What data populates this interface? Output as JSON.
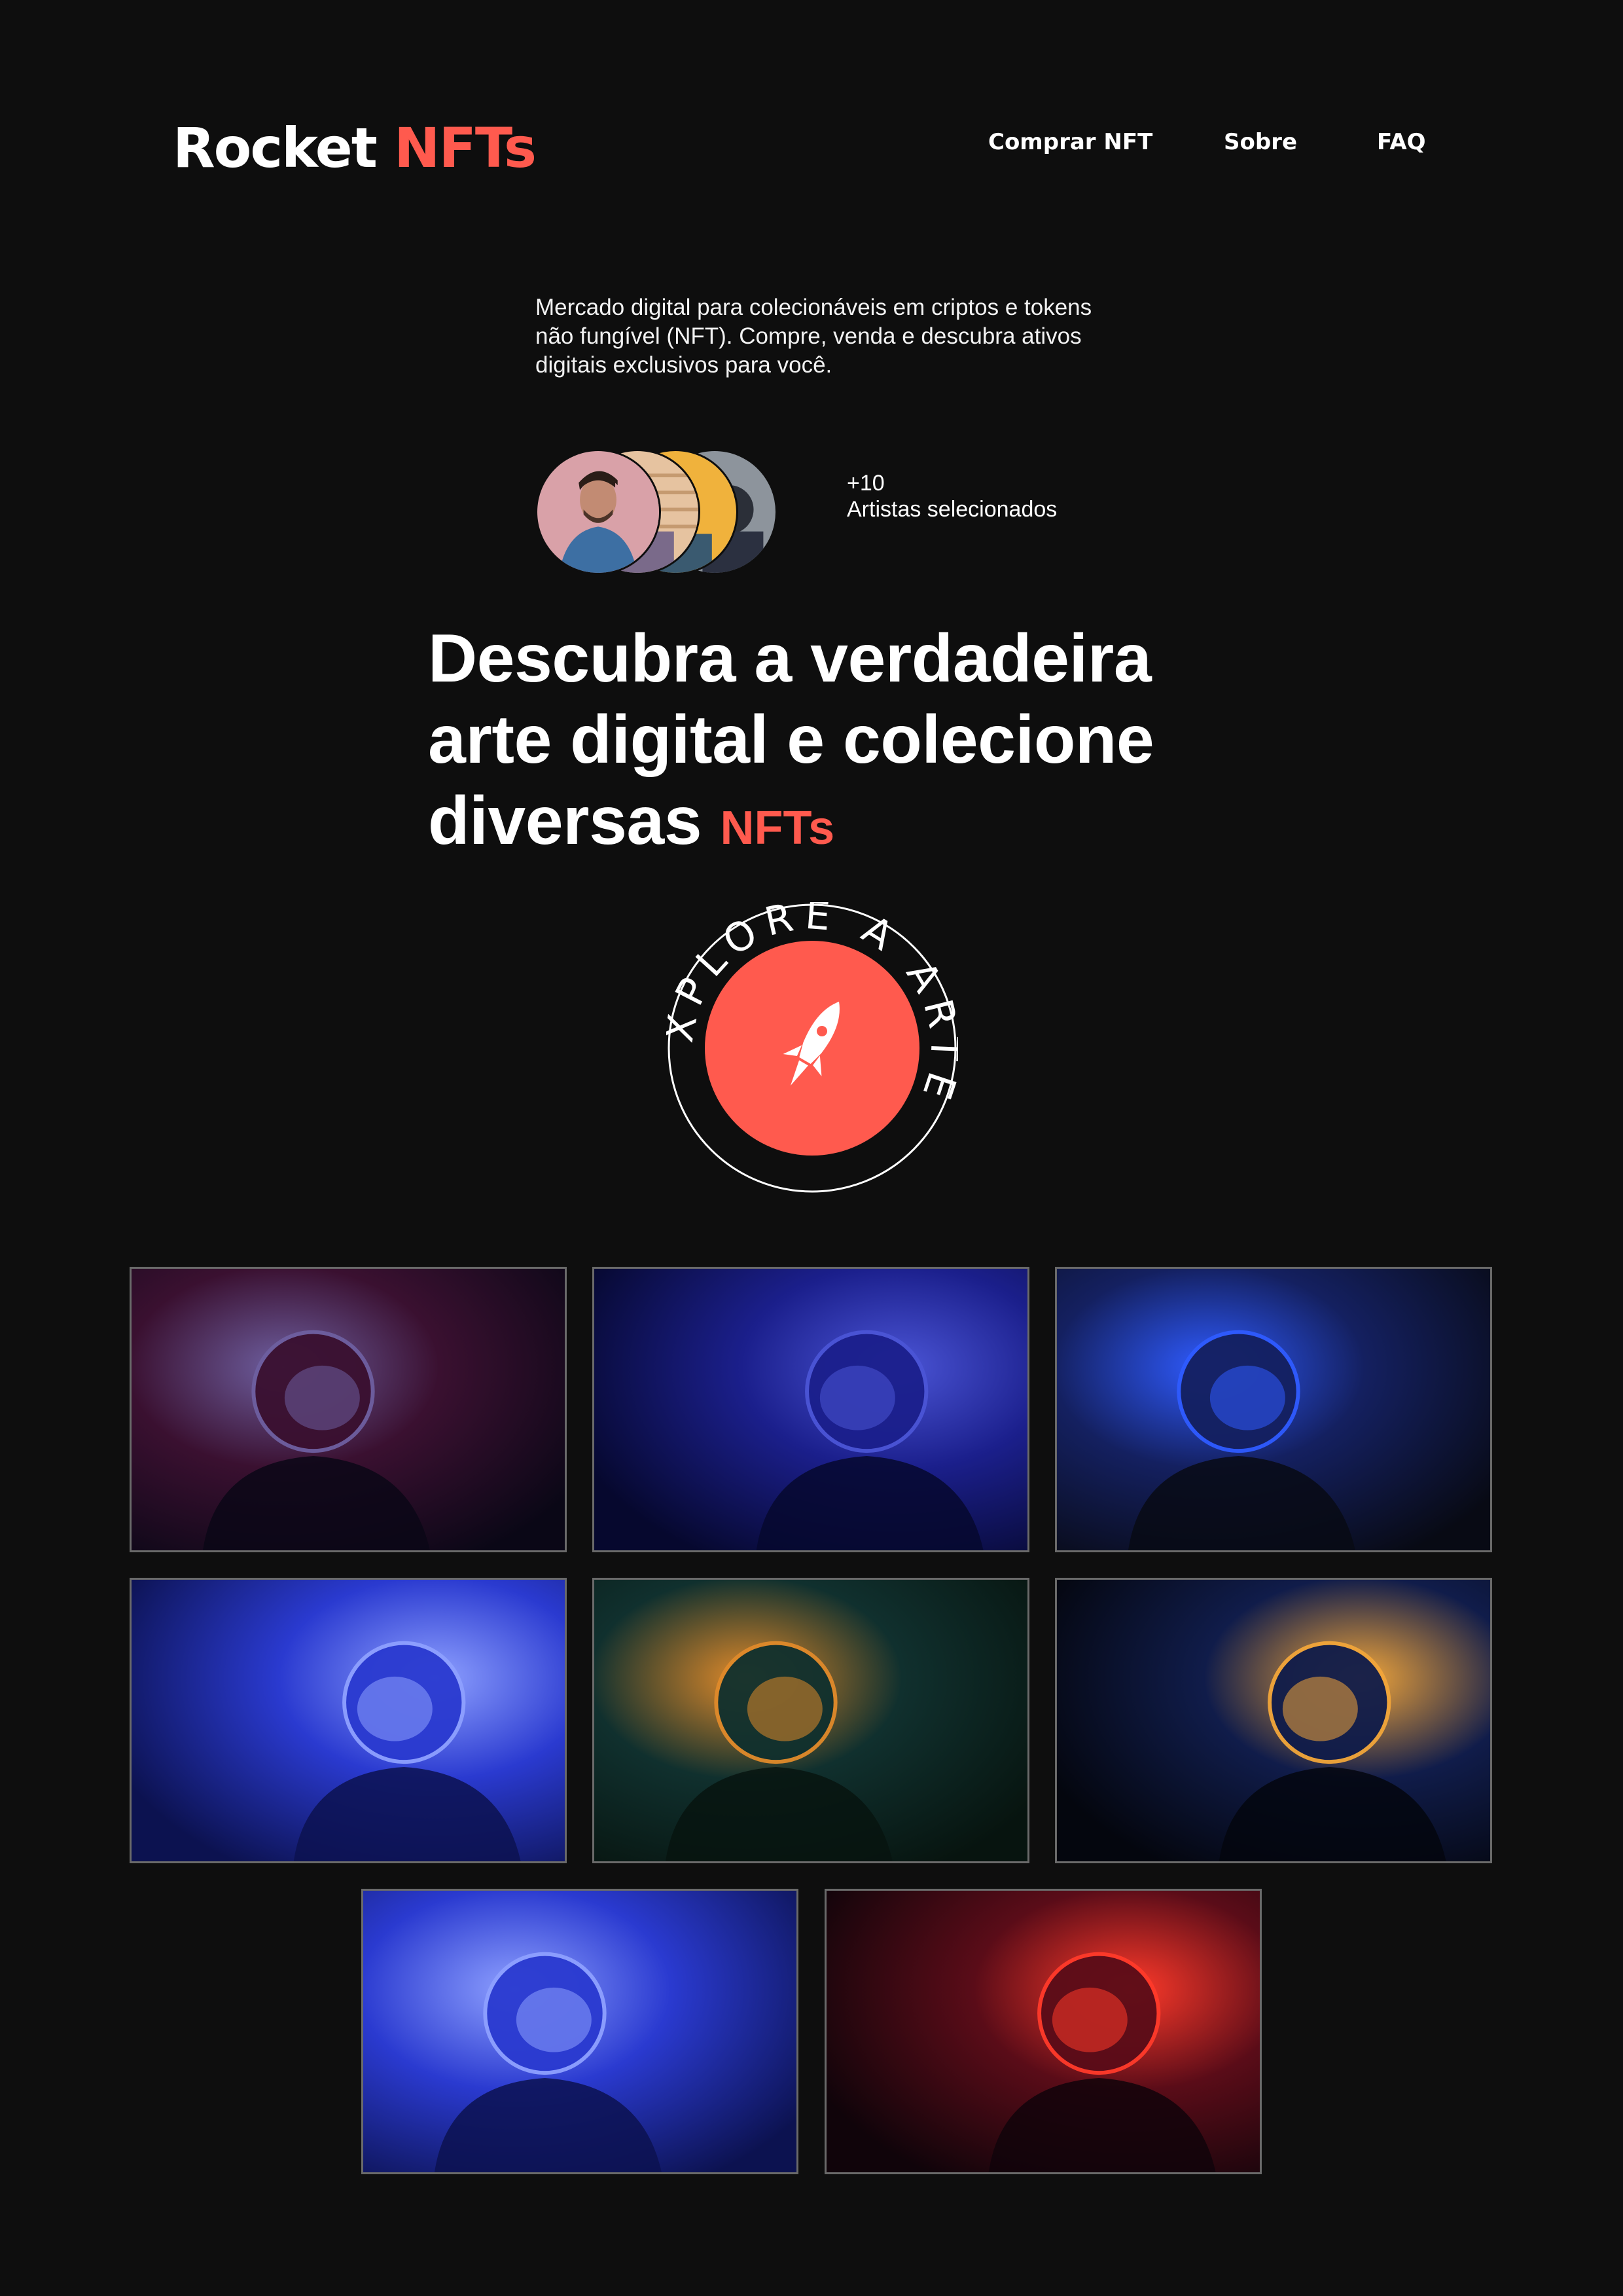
{
  "header": {
    "logo_main": "Rocket",
    "logo_accent": "NFTs",
    "nav": [
      "Comprar NFT",
      "Sobre",
      "FAQ"
    ]
  },
  "intro": {
    "description": "Mercado digital para colecionáveis em criptos e tokens não fungível (NFT). Compre, venda e descubra ativos digitais exclusivos para você.",
    "artists_count": "+10",
    "artists_label": "Artistas selecionados"
  },
  "headline": {
    "line1": "Descubra a verdadeira",
    "line2": "arte digital e colecione",
    "line3": "diversas",
    "accent": "NFTs"
  },
  "badge": {
    "text": "EXPLORE A ARTE",
    "icon": "rocket-icon"
  },
  "colors": {
    "background": "#0e0e0e",
    "accent": "#ff5a4e",
    "text": "#ffffff"
  },
  "gallery": [
    {
      "icon": "astronaut-photo",
      "palette": [
        "#0a0716",
        "#3a1030",
        "#6e5fa0"
      ]
    },
    {
      "icon": "astronaut-photo",
      "palette": [
        "#06082e",
        "#1b1f8c",
        "#4b55d6"
      ]
    },
    {
      "icon": "astronaut-photo",
      "palette": [
        "#080a14",
        "#142060",
        "#2f5bff"
      ]
    },
    {
      "icon": "astronaut-photo",
      "palette": [
        "#0c1250",
        "#2a3ad0",
        "#8ea0ff"
      ]
    },
    {
      "icon": "astronaut-photo",
      "palette": [
        "#07140f",
        "#10302e",
        "#e08a2a"
      ]
    },
    {
      "icon": "astronaut-photo",
      "palette": [
        "#04060e",
        "#101c4a",
        "#f2a63a"
      ]
    },
    {
      "icon": "astronaut-photo",
      "palette": [
        "#0c1250",
        "#2a3ad0",
        "#8ea0ff"
      ]
    },
    {
      "icon": "astronaut-photo",
      "palette": [
        "#10040a",
        "#5a0c18",
        "#ff3a2a"
      ]
    }
  ]
}
